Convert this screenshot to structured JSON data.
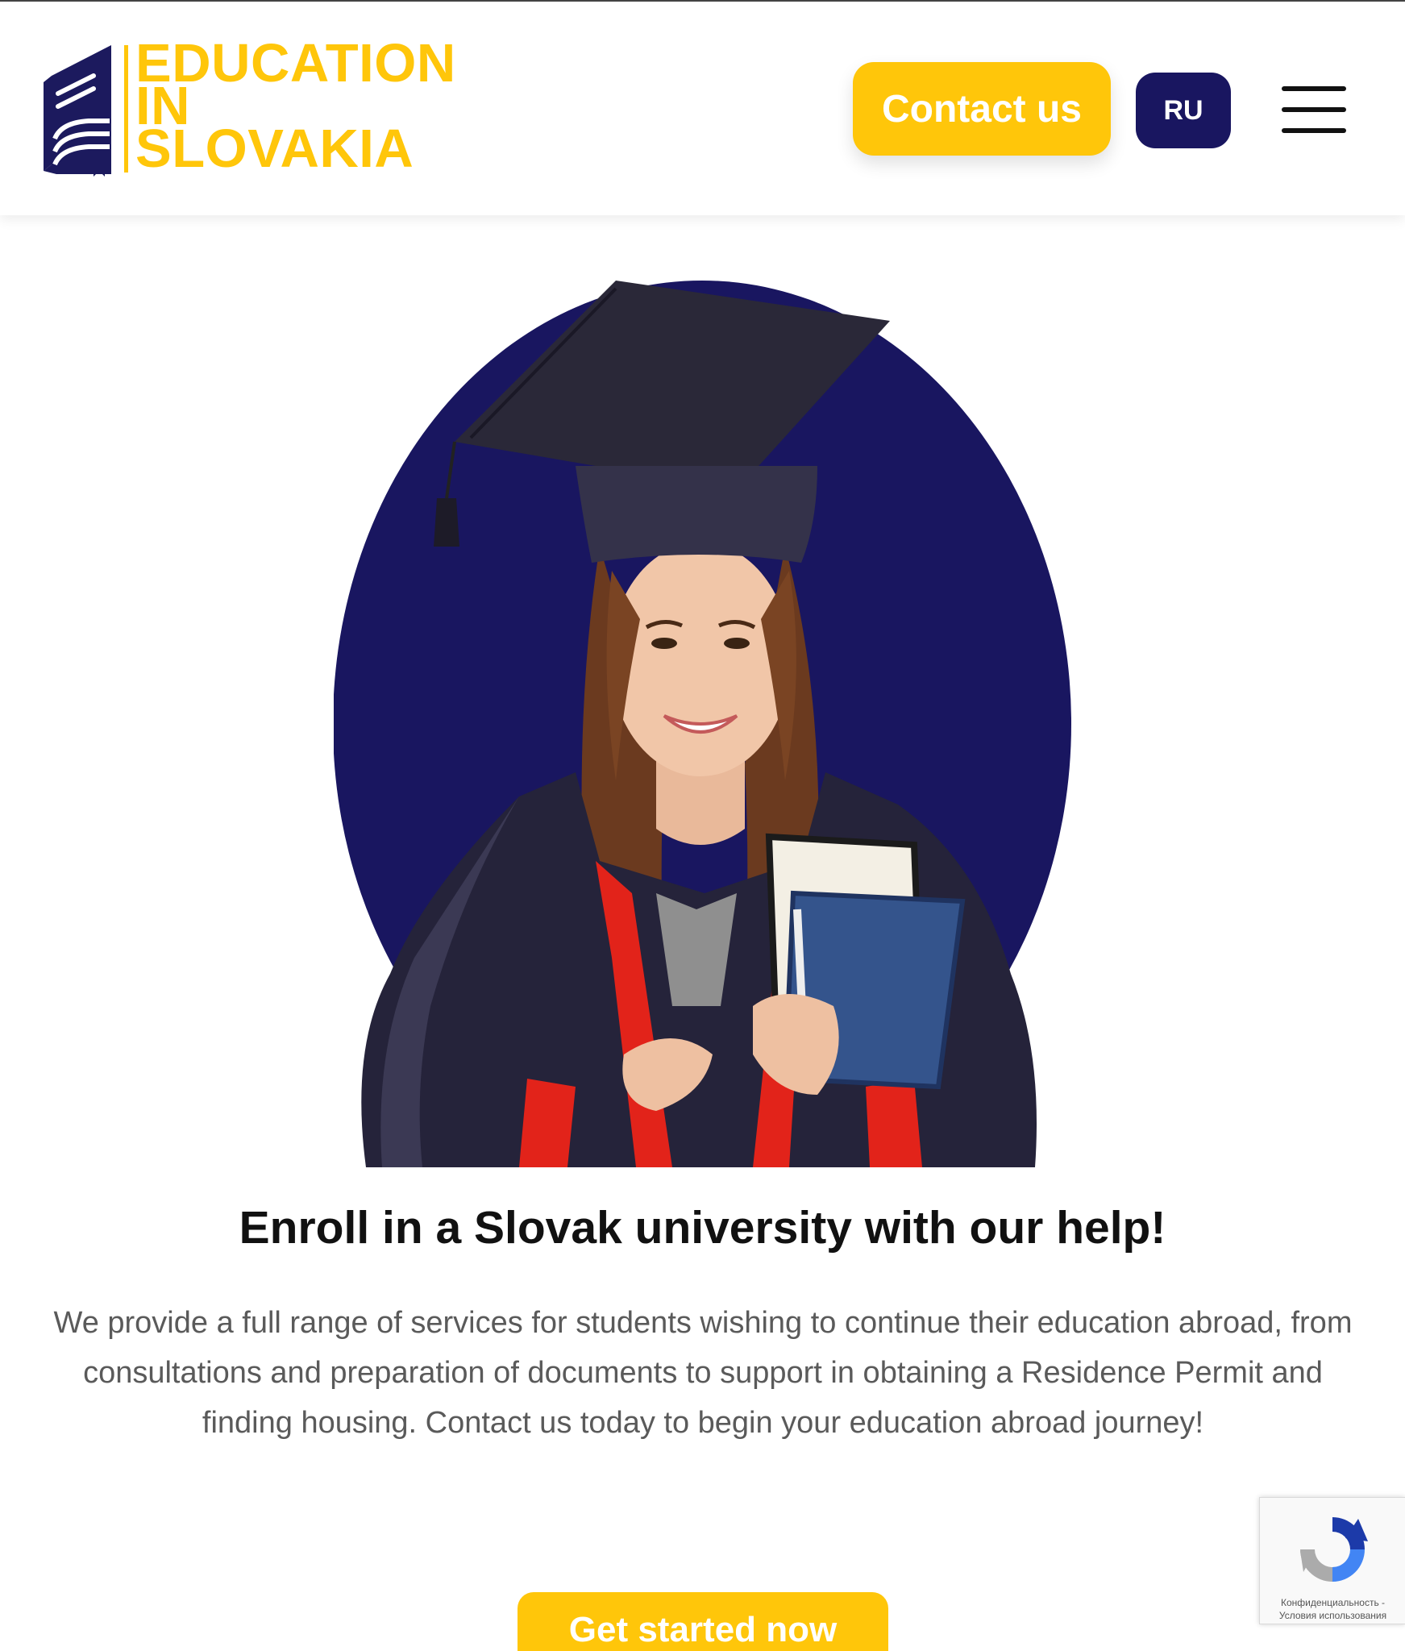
{
  "header": {
    "logo_lines": [
      "EDUCATION",
      "IN",
      "SLOVAKIA"
    ],
    "contact_label": "Contact us",
    "language_label": "RU"
  },
  "hero": {
    "title": "Enroll in a Slovak university with our help!",
    "description": "We provide a full range of services for students wishing to continue their education abroad, from consultations and preparation of documents to support in obtaining a Residence Permit and finding housing. Contact us today to begin your education abroad journey!",
    "cta_label": "Get started now"
  },
  "recaptcha": {
    "privacy_label": "Конфиденциальность -",
    "terms_label": "Условия использования"
  },
  "colors": {
    "brand_yellow": "#ffc60a",
    "brand_navy": "#191660"
  },
  "icons": {
    "logo": "book-icon",
    "menu": "hamburger-menu-icon",
    "recaptcha": "recaptcha-icon"
  }
}
